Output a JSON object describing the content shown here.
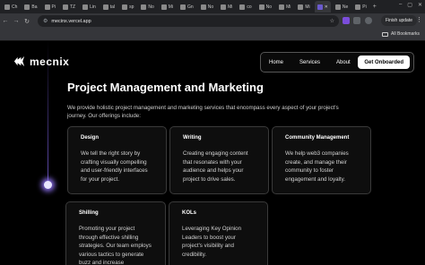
{
  "browser": {
    "tabs": [
      {
        "label": "Ch",
        "active": false
      },
      {
        "label": "Ba",
        "active": false
      },
      {
        "label": "Pi",
        "active": false
      },
      {
        "label": "TZ",
        "active": false
      },
      {
        "label": "Lin",
        "active": false
      },
      {
        "label": "tal",
        "active": false
      },
      {
        "label": "sp",
        "active": false
      },
      {
        "label": "No",
        "active": false
      },
      {
        "label": "Mi",
        "active": false
      },
      {
        "label": "Gn",
        "active": false
      },
      {
        "label": "No",
        "active": false
      },
      {
        "label": "Mi",
        "active": false
      },
      {
        "label": "co",
        "active": false
      },
      {
        "label": "No",
        "active": false
      },
      {
        "label": "Mi",
        "active": false
      },
      {
        "label": "Mi",
        "active": false
      },
      {
        "label": "",
        "active": true
      },
      {
        "label": "Ne",
        "active": false
      },
      {
        "label": "Pi",
        "active": false
      }
    ],
    "url": "mecinx.vercel.app",
    "finish_update_label": "Finish update",
    "all_bookmarks_label": "All Bookmarks"
  },
  "site": {
    "logo_text": "mecnix",
    "nav": {
      "home": "Home",
      "services": "Services",
      "about": "About",
      "cta": "Get Onboarded"
    },
    "headline": "Project Management and Marketing",
    "intro": "We provide holistic project management and marketing services that encompass every aspect of your project's journey. Our offerings include:",
    "cards": [
      {
        "title": "Design",
        "body": "We tell the right story by crafting visually compelling and user-friendly interfaces for your project."
      },
      {
        "title": "Writing",
        "body": "Creating engaging content that resonates with your audience and helps your project to drive sales."
      },
      {
        "title": "Community Management",
        "body": "We help web3 companies create, and manage their community to foster engagement and loyalty."
      },
      {
        "title": "Shilling",
        "body": "Promoting your project through effective shilling strategies. Our team employs various tactics to generate buzz and increase"
      },
      {
        "title": "KOLs",
        "body": "Leveraging Key Opinion Leaders to boost your project's visibility and credibility."
      }
    ]
  },
  "colors": {
    "background": "#000000",
    "accent_glow": "#8c6eff",
    "card_border": "#3a3a3a"
  }
}
